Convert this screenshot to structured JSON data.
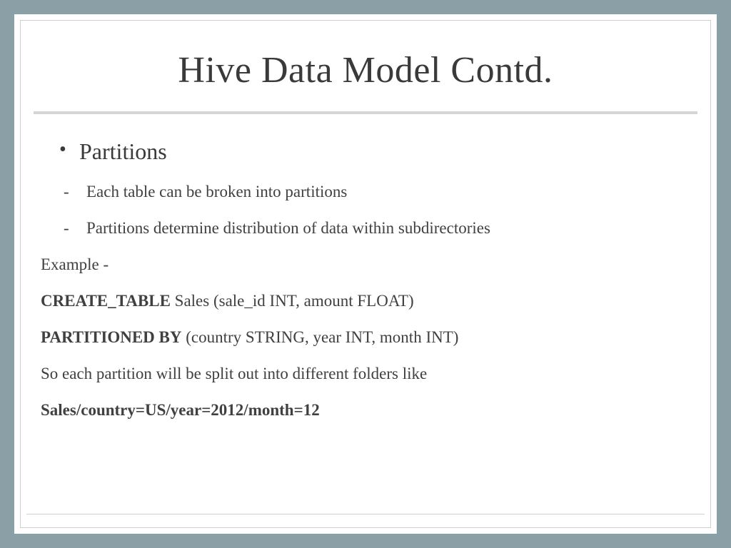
{
  "title": "Hive Data Model Contd.",
  "bullet_main": "Partitions",
  "sub1": "Each table can be broken into partitions",
  "sub2": "Partitions determine distribution of data within subdirectories",
  "example_label": "Example -",
  "code1_bold": "CREATE_TABLE",
  "code1_rest": " Sales (sale_id INT, amount FLOAT)",
  "code2_bold": "PARTITIONED BY",
  "code2_rest": " (country STRING, year INT, month INT)",
  "explain": "So each partition will be split out into different folders like",
  "path": "Sales/country=US/year=2012/month=12"
}
